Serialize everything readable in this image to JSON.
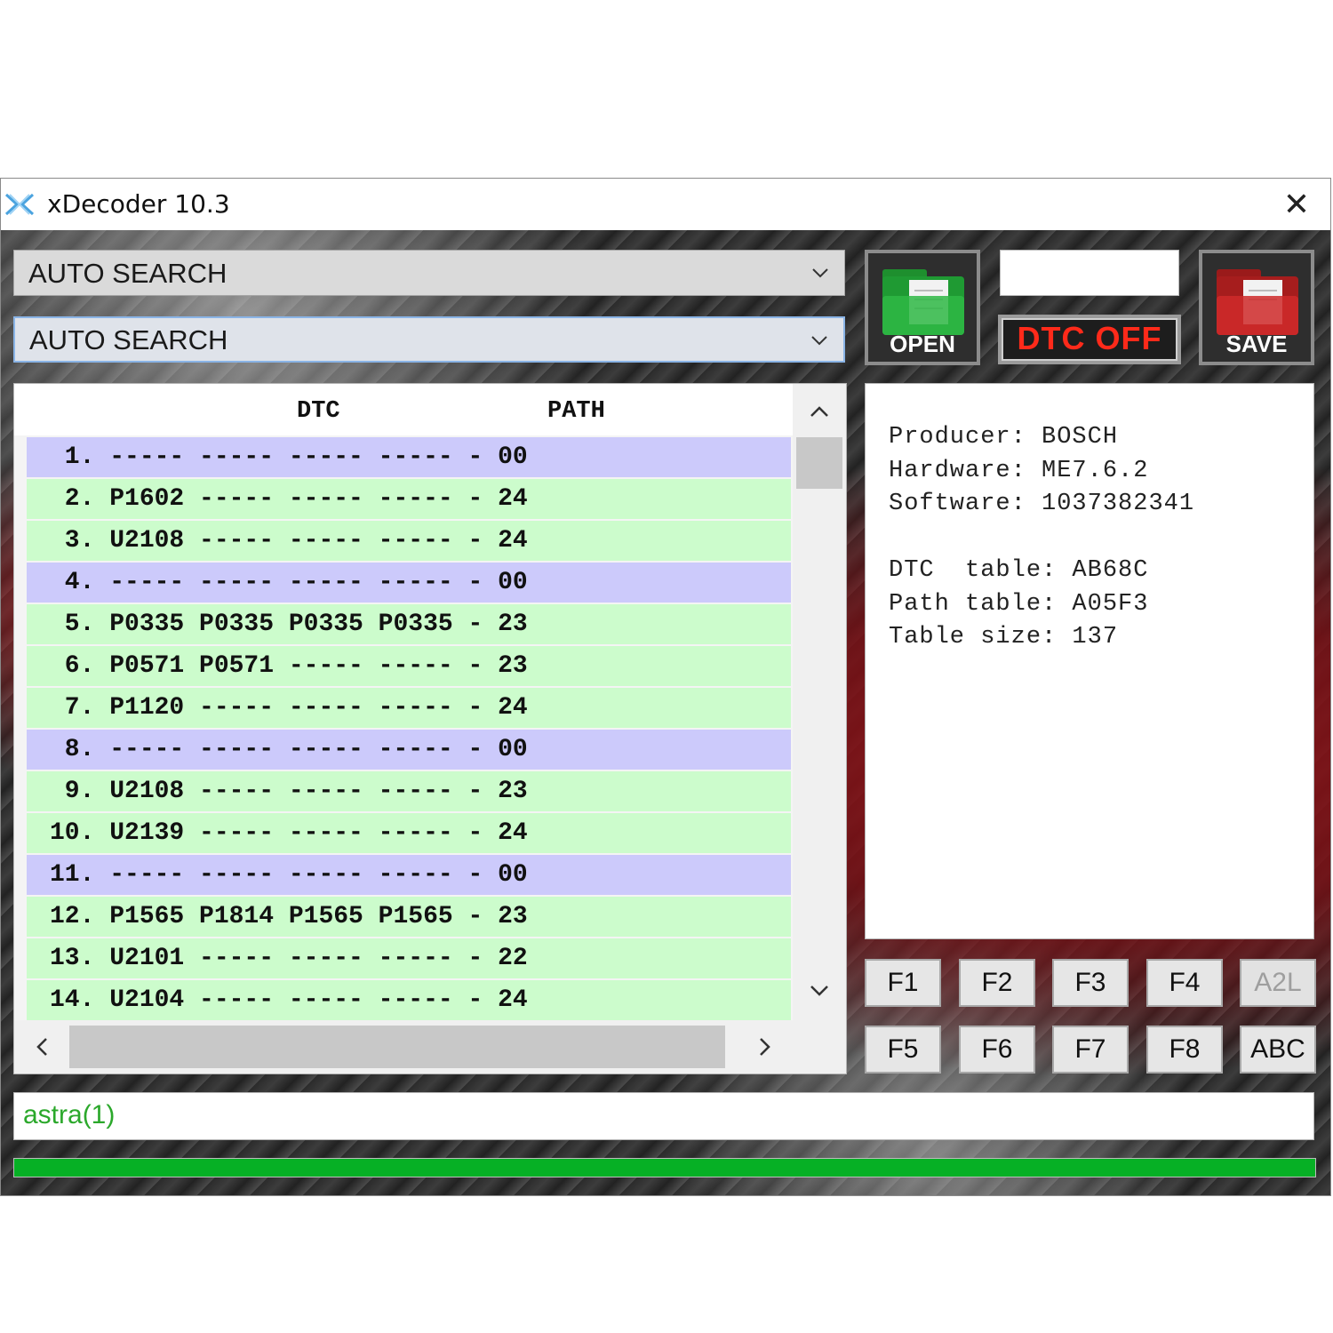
{
  "window": {
    "title": "xDecoder 10.3",
    "close_glyph": "✕"
  },
  "combos": [
    {
      "value": "AUTO SEARCH"
    },
    {
      "value": "AUTO SEARCH"
    }
  ],
  "toolbar": {
    "open_label": "OPEN",
    "dtc_off_label": "DTC OFF",
    "save_label": "SAVE",
    "text_box_value": ""
  },
  "list": {
    "headers": {
      "dtc": "DTC",
      "path": "PATH"
    },
    "rows": [
      {
        "text": " 1. ----- ----- ----- ----- - 00",
        "type": "blue"
      },
      {
        "text": " 2. P1602 ----- ----- ----- - 24",
        "type": "green"
      },
      {
        "text": " 3. U2108 ----- ----- ----- - 24",
        "type": "green"
      },
      {
        "text": " 4. ----- ----- ----- ----- - 00",
        "type": "blue"
      },
      {
        "text": " 5. P0335 P0335 P0335 P0335 - 23",
        "type": "green"
      },
      {
        "text": " 6. P0571 P0571 ----- ----- - 23",
        "type": "green"
      },
      {
        "text": " 7. P1120 ----- ----- ----- - 24",
        "type": "green"
      },
      {
        "text": " 8. ----- ----- ----- ----- - 00",
        "type": "blue"
      },
      {
        "text": " 9. U2108 ----- ----- ----- - 23",
        "type": "green"
      },
      {
        "text": "10. U2139 ----- ----- ----- - 24",
        "type": "green"
      },
      {
        "text": "11. ----- ----- ----- ----- - 00",
        "type": "blue"
      },
      {
        "text": "12. P1565 P1814 P1565 P1565 - 23",
        "type": "green"
      },
      {
        "text": "13. U2101 ----- ----- ----- - 22",
        "type": "green"
      },
      {
        "text": "14. U2104 ----- ----- ----- - 24",
        "type": "green"
      }
    ]
  },
  "info": {
    "producer": "Producer: BOSCH",
    "hardware": "Hardware: ME7.6.2",
    "software": "Software: 1037382341",
    "dtc_table": "DTC  table: AB68C",
    "path_table": "Path table: A05F3",
    "table_size": "Table size: 137"
  },
  "function_keys": {
    "row1": [
      "F1",
      "F2",
      "F3",
      "F4",
      "A2L"
    ],
    "row2": [
      "F5",
      "F6",
      "F7",
      "F8",
      "ABC"
    ]
  },
  "status": {
    "text": "astra(1)",
    "progress_fraction": 1.0
  },
  "colors": {
    "row_green": "#ccfccc",
    "row_blue": "#cccafb",
    "status_text": "#2ba82b",
    "progress_fill": "#06b025",
    "dtc_off_text": "#ff2a1a"
  },
  "icons": {
    "app": "xdecoder-logo-icon",
    "open": "green-folder-icon",
    "save": "red-folder-icon",
    "combo_arrow": "chevron-down-icon",
    "scroll_up": "chevron-up-icon",
    "scroll_down": "chevron-down-icon",
    "scroll_left": "chevron-left-icon",
    "scroll_right": "chevron-right-icon"
  }
}
